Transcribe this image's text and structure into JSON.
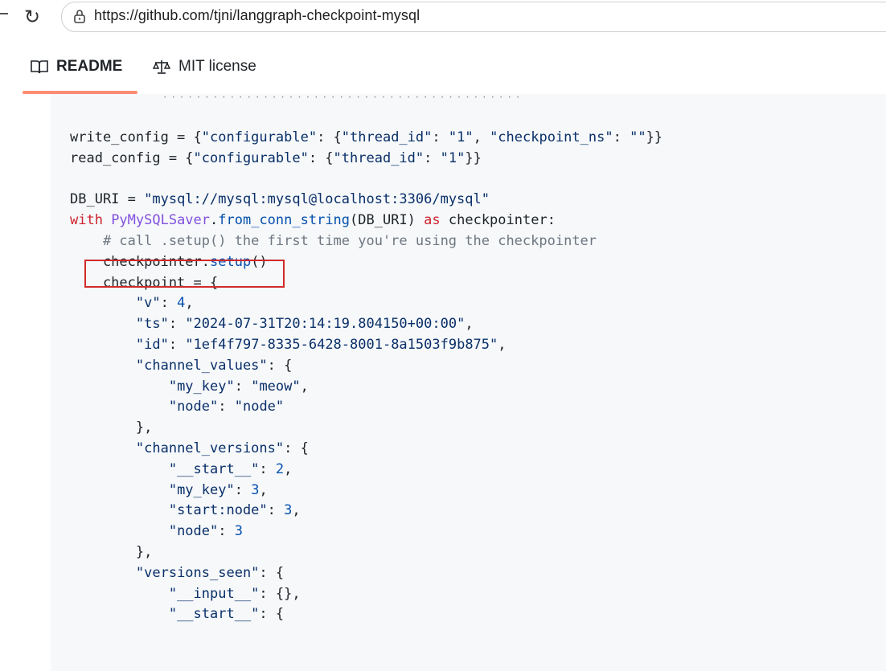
{
  "browser": {
    "url": "https://github.com/tjni/langgraph-checkpoint-mysql"
  },
  "tabs": [
    {
      "label": "README",
      "active": true
    },
    {
      "label": "MIT license",
      "active": false
    }
  ],
  "colors": {
    "tab_accent": "#fd8c73",
    "highlight_border": "#d12a2a",
    "string": "#0a3069",
    "keyword": "#cf222e",
    "function": "#8250df",
    "number": "#0550ae"
  },
  "code": {
    "l1": {
      "a": "write_config = {",
      "s1": "\"configurable\"",
      "b": ": {",
      "s2": "\"thread_id\"",
      "c": ": ",
      "s3": "\"1\"",
      "d": ", ",
      "s4": "\"checkpoint_ns\"",
      "e": ": ",
      "s5": "\"\"",
      "f": "}}"
    },
    "l2": {
      "a": "read_config = {",
      "s1": "\"configurable\"",
      "b": ": {",
      "s2": "\"thread_id\"",
      "c": ": ",
      "s3": "\"1\"",
      "d": "}}"
    },
    "l4": {
      "a": "DB_URI = ",
      "s1": "\"mysql://mysql:mysql@localhost:3306/mysql\""
    },
    "l5": {
      "k1": "with ",
      "f1": "PyMySQLSaver",
      "a": ".",
      "f2": "from_conn_string",
      "b": "(DB_URI) ",
      "k2": "as",
      "c": " checkpointer:"
    },
    "l6": {
      "comment": "    # call .setup() the first time you're using the checkpointer"
    },
    "l7": {
      "a": "    checkpointer.",
      "f1": "setup",
      "b": "()"
    },
    "l8": {
      "a": "    checkpoint = {"
    },
    "l9": {
      "a": "        ",
      "s1": "\"v\"",
      "b": ": ",
      "n1": "4",
      "c": ","
    },
    "l10": {
      "a": "        ",
      "s1": "\"ts\"",
      "b": ": ",
      "s2": "\"2024-07-31T20:14:19.804150+00:00\"",
      "c": ","
    },
    "l11": {
      "a": "        ",
      "s1": "\"id\"",
      "b": ": ",
      "s2": "\"1ef4f797-8335-6428-8001-8a1503f9b875\"",
      "c": ","
    },
    "l12": {
      "a": "        ",
      "s1": "\"channel_values\"",
      "b": ": {"
    },
    "l13": {
      "a": "            ",
      "s1": "\"my_key\"",
      "b": ": ",
      "s2": "\"meow\"",
      "c": ","
    },
    "l14": {
      "a": "            ",
      "s1": "\"node\"",
      "b": ": ",
      "s2": "\"node\""
    },
    "l15": {
      "a": "        },"
    },
    "l16": {
      "a": "        ",
      "s1": "\"channel_versions\"",
      "b": ": {"
    },
    "l17": {
      "a": "            ",
      "s1": "\"__start__\"",
      "b": ": ",
      "n1": "2",
      "c": ","
    },
    "l18": {
      "a": "            ",
      "s1": "\"my_key\"",
      "b": ": ",
      "n1": "3",
      "c": ","
    },
    "l19": {
      "a": "            ",
      "s1": "\"start:node\"",
      "b": ": ",
      "n1": "3",
      "c": ","
    },
    "l20": {
      "a": "            ",
      "s1": "\"node\"",
      "b": ": ",
      "n1": "3"
    },
    "l21": {
      "a": "        },"
    },
    "l22": {
      "a": "        ",
      "s1": "\"versions_seen\"",
      "b": ": {"
    },
    "l23": {
      "a": "            ",
      "s1": "\"__input__\"",
      "b": ": {},"
    },
    "l24": {
      "a": "            ",
      "s1": "\"__start__\"",
      "b": ": {"
    }
  }
}
